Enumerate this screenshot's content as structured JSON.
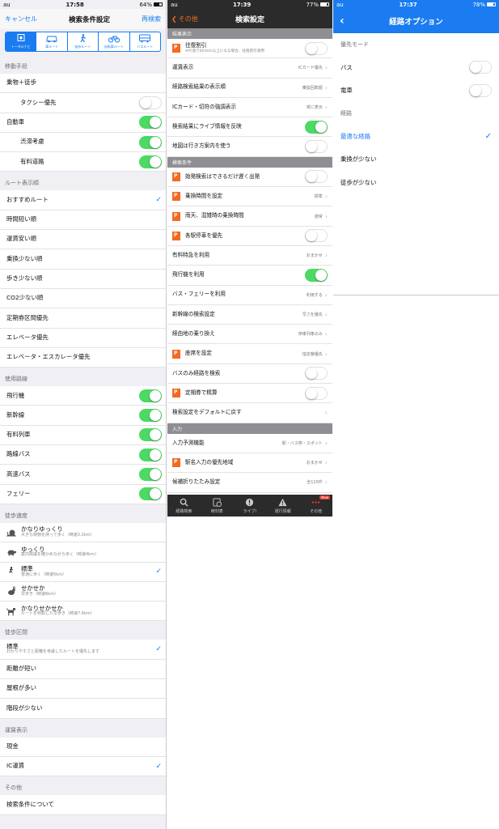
{
  "p1": {
    "status": {
      "carrier": "au",
      "time": "17:58",
      "battery": "64%",
      "battery_level": 0.64
    },
    "nav": {
      "left": "キャンセル",
      "title": "検索条件設定",
      "right": "再検索"
    },
    "segments": [
      {
        "label": "トータルナビ",
        "icon": "total-navi-icon",
        "on": true
      },
      {
        "label": "車ルート",
        "icon": "car-icon",
        "on": false
      },
      {
        "label": "徒歩ルート",
        "icon": "walker-icon",
        "on": false
      },
      {
        "label": "自転車ルート",
        "icon": "bicycle-icon",
        "on": false
      },
      {
        "label": "バスルート",
        "icon": "bus-icon",
        "on": false
      }
    ],
    "sections": [
      {
        "header": "移動手段",
        "rows": [
          {
            "label": "乗物＋徒歩",
            "type": "plain"
          },
          {
            "label": "タクシー優先",
            "type": "toggle",
            "on": false,
            "indent": true
          },
          {
            "label": "自動車",
            "type": "toggle",
            "on": true
          },
          {
            "label": "渋滞考慮",
            "type": "toggle",
            "on": true,
            "indent": true
          },
          {
            "label": "有料道路",
            "type": "toggle",
            "on": true,
            "indent": true
          }
        ]
      },
      {
        "header": "ルート表示順",
        "rows": [
          {
            "label": "おすすめルート",
            "type": "check",
            "on": true
          },
          {
            "label": "時間短い順",
            "type": "check",
            "on": false
          },
          {
            "label": "運賃安い順",
            "type": "check",
            "on": false
          },
          {
            "label": "乗換少ない順",
            "type": "check",
            "on": false
          },
          {
            "label": "歩き少ない順",
            "type": "check",
            "on": false
          },
          {
            "label": "CO2少ない順",
            "type": "check",
            "on": false
          },
          {
            "label": "定期券区間優先",
            "type": "check",
            "on": false
          },
          {
            "label": "エレベータ優先",
            "type": "check",
            "on": false
          },
          {
            "label": "エレベータ・エスカレータ優先",
            "type": "check",
            "on": false
          }
        ]
      },
      {
        "header": "使用路線",
        "rows": [
          {
            "label": "飛行機",
            "type": "toggle",
            "on": true
          },
          {
            "label": "新幹線",
            "type": "toggle",
            "on": true
          },
          {
            "label": "有料列車",
            "type": "toggle",
            "on": true
          },
          {
            "label": "路線バス",
            "type": "toggle",
            "on": true
          },
          {
            "label": "高速バス",
            "type": "toggle",
            "on": true
          },
          {
            "label": "フェリー",
            "type": "toggle",
            "on": true
          }
        ]
      },
      {
        "header": "徒歩速度",
        "rows": [
          {
            "label": "かなりゆっくり",
            "sub": "大きな荷物を持って歩く（時速3.2km）",
            "type": "check",
            "on": false,
            "icon": "snail-icon"
          },
          {
            "label": "ゆっくり",
            "sub": "案内標識を確かめながら歩く（時速4km）",
            "type": "check",
            "on": false,
            "icon": "turtle-icon"
          },
          {
            "label": "標準",
            "sub": "普通に歩く（時速5km）",
            "type": "check",
            "on": true,
            "icon": "walker-icon"
          },
          {
            "label": "せかせか",
            "sub": "早歩き（時速6km）",
            "type": "check",
            "on": false,
            "icon": "rabbit-icon"
          },
          {
            "label": "かなりせかせか",
            "sub": "ルートを熟知した早歩き（時速7.6km）",
            "type": "check",
            "on": false,
            "icon": "dog-icon"
          }
        ]
      },
      {
        "header": "徒歩区間",
        "rows": [
          {
            "label": "標準",
            "sub": "わかりやすさと距離を考慮したルートを優先します",
            "type": "check",
            "on": true
          },
          {
            "label": "距離が短い",
            "type": "check",
            "on": false
          },
          {
            "label": "屋根が多い",
            "type": "check",
            "on": false
          },
          {
            "label": "階段が少ない",
            "type": "check",
            "on": false
          }
        ]
      },
      {
        "header": "運賃表示",
        "rows": [
          {
            "label": "現金",
            "type": "check",
            "on": false
          },
          {
            "label": "IC運賃",
            "type": "check",
            "on": true
          }
        ]
      },
      {
        "header": "その他",
        "rows": [
          {
            "label": "検索条件について",
            "type": "plain"
          }
        ]
      }
    ]
  },
  "p2": {
    "status": {
      "carrier": "au",
      "time": "17:39",
      "battery": "77%",
      "battery_level": 0.77
    },
    "nav": {
      "back": "その他",
      "title": "検索設定"
    },
    "sections": [
      {
        "header": "結果表示",
        "rows": [
          {
            "label": "往復割引",
            "sub": "※片道で601km以上になる場合、往復割引適用",
            "type": "toggle",
            "on": false,
            "badge": true
          },
          {
            "label": "運賃表示",
            "value": "ICカード優先",
            "type": "value"
          },
          {
            "label": "経路検索結果の表示順",
            "value": "乗換回数順",
            "type": "value"
          },
          {
            "label": "ICカード・切符の強調表示",
            "value": "常に表示",
            "type": "value"
          },
          {
            "label": "検索結果にライブ情報を反映",
            "type": "toggle",
            "on": true
          },
          {
            "label": "地図は行き方案内を使う",
            "type": "toggle",
            "on": false
          }
        ]
      },
      {
        "header": "検索条件",
        "rows": [
          {
            "label": "始発検索はできるだけ遅く出発",
            "type": "toggle",
            "on": false,
            "badge": true
          },
          {
            "label": "乗換時間を設定",
            "value": "標準",
            "type": "value",
            "badge": true
          },
          {
            "label": "雨天、混雑時の乗換時間",
            "value": "通常",
            "type": "value",
            "badge": true
          },
          {
            "label": "各駅停車を優先",
            "type": "toggle",
            "on": false,
            "badge": true
          },
          {
            "label": "有料特急を利用",
            "value": "おまかせ",
            "type": "value"
          },
          {
            "label": "飛行機を利用",
            "type": "toggle",
            "on": true
          },
          {
            "label": "バス・フェリーを利用",
            "value": "利用する",
            "type": "value"
          },
          {
            "label": "新幹線の検索設定",
            "value": "早さを優先",
            "type": "value"
          },
          {
            "label": "経由地の乗り換え",
            "value": "停車列車のみ",
            "type": "value"
          },
          {
            "label": "座席を設定",
            "value": "指定席優先",
            "type": "value",
            "badge": true
          },
          {
            "label": "バスのみ経路を検索",
            "type": "toggle",
            "on": false
          },
          {
            "label": "定期券で精算",
            "type": "toggle",
            "on": false,
            "badge": true
          },
          {
            "label": "検索設定をデフォルトに戻す",
            "type": "value",
            "value": ""
          }
        ]
      },
      {
        "header": "入力",
        "rows": [
          {
            "label": "入力予測機能",
            "value": "駅・バス停・スポット",
            "type": "value"
          },
          {
            "label": "駅名入力の優先地域",
            "value": "おまかせ",
            "type": "value",
            "badge": true
          },
          {
            "label": "候補折りたたみ設定",
            "value": "全115件",
            "type": "value"
          }
        ]
      }
    ],
    "tabs": [
      {
        "label": "経路検索",
        "icon": "search-icon"
      },
      {
        "label": "時刻表",
        "icon": "timetable-icon"
      },
      {
        "label": "ライブ!",
        "icon": "live-icon"
      },
      {
        "label": "運行情報",
        "icon": "warning-icon"
      },
      {
        "label": "その他",
        "icon": "more-icon",
        "badge": "New"
      }
    ]
  },
  "p3": {
    "status": {
      "carrier": "au",
      "time": "17:37",
      "battery": "78%",
      "battery_level": 0.78
    },
    "nav": {
      "title": "経路オプション"
    },
    "sections": [
      {
        "header": "優先モード",
        "rows": [
          {
            "label": "バス",
            "type": "toggle",
            "on": false
          },
          {
            "label": "電車",
            "type": "toggle",
            "on": false
          }
        ]
      },
      {
        "header": "経路",
        "rows": [
          {
            "label": "最適な経路",
            "type": "check",
            "on": true
          },
          {
            "label": "乗換が少ない",
            "type": "check",
            "on": false
          },
          {
            "label": "徒歩が少ない",
            "type": "check",
            "on": false
          }
        ]
      }
    ]
  },
  "colors": {
    "ios_blue": "#1a7cf0",
    "ios_green": "#4cd964",
    "orange": "#f26a22",
    "dark_bar": "#2b2b2b"
  }
}
